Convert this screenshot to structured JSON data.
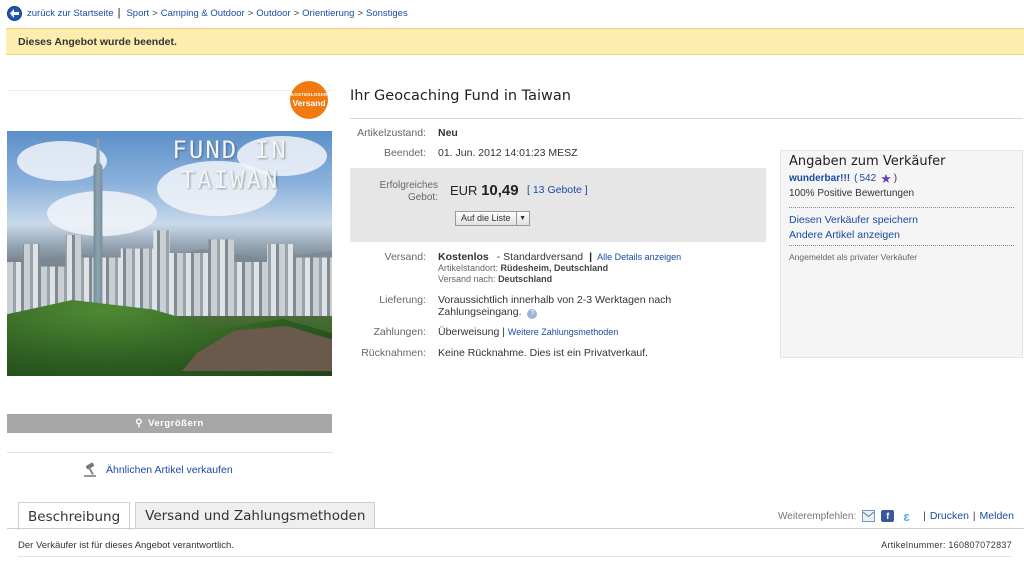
{
  "breadcrumb": {
    "back_label": "zurück zur Startseite",
    "separator": "|",
    "path": [
      "Sport",
      "Camping & Outdoor",
      "Outdoor",
      "Orientierung",
      "Sonstiges"
    ]
  },
  "banner": {
    "text": "Dieses Angebot wurde beendet."
  },
  "image": {
    "caption_line1": "FUND IN",
    "caption_line2": "TAIWAN",
    "badge_small": "KOSTENLOSER",
    "badge_big": "Versand",
    "enlarge_label": "Vergrößern",
    "sell_similar_label": "Ähnlichen Artikel verkaufen"
  },
  "item": {
    "title": "Ihr Geocaching Fund in Taiwan",
    "condition_label": "Artikelzustand:",
    "condition_value": "Neu",
    "ended_label": "Beendet:",
    "ended_value": "01. Jun. 2012 14:01:23 MESZ",
    "bid_label_line1": "Erfolgreiches",
    "bid_label_line2": "Gebot:",
    "currency": "EUR",
    "price": "10,49",
    "bids_link": "13 Gebote",
    "watch_button": "Auf die Liste"
  },
  "shipping": {
    "label": "Versand:",
    "cost": "Kostenlos",
    "method": "- Standardversand",
    "details_link": "Alle Details anzeigen",
    "location_label": "Artikelstandort:",
    "location_value": "Rüdesheim, Deutschland",
    "ships_to_label": "Versand nach:",
    "ships_to_value": "Deutschland"
  },
  "delivery": {
    "label": "Lieferung:",
    "line1": "Voraussichtlich innerhalb von 2-3 Werktagen nach",
    "line2": "Zahlungseingang."
  },
  "payment": {
    "label": "Zahlungen:",
    "value": "Überweisung",
    "more_link": "Weitere Zahlungsmethoden"
  },
  "returns": {
    "label": "Rücknahmen:",
    "value": "Keine Rücknahme. Dies ist ein Privatverkauf."
  },
  "seller": {
    "heading": "Angaben zum Verkäufer",
    "name": "wunderbar!!!",
    "feedback_count": "542",
    "positive": "100% Positive Bewertungen",
    "save_link": "Diesen Verkäufer speichern",
    "other_items_link": "Andere Artikel anzeigen",
    "note": "Angemeldet als privater Verkäufer"
  },
  "tabs": [
    {
      "label": "Beschreibung"
    },
    {
      "label": "Versand und Zahlungsmethoden"
    }
  ],
  "share": {
    "label": "Weiterempfehlen:",
    "print": "Drucken",
    "report": "Melden"
  },
  "footer": {
    "responsible": "Der Verkäufer ist für dieses Angebot verantwortlich.",
    "item_number_label": "Artikelnummer:",
    "item_number": "160807072837"
  },
  "colors": {
    "link": "#1a4ba3",
    "banner": "#fdeeb0",
    "badge": "#f07a10"
  }
}
